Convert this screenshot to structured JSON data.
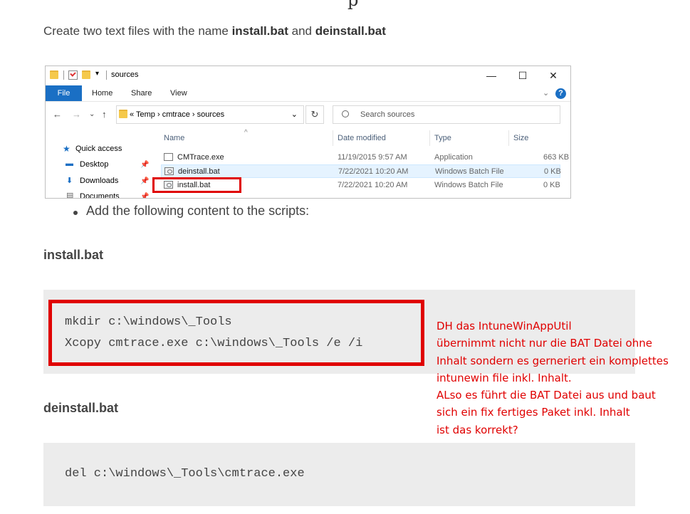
{
  "page": {
    "top_heading_fragment": "p",
    "intro_prefix": "Create two text files with the name ",
    "intro_file1": "install.bat",
    "intro_mid": " and ",
    "intro_file2": "deinstall.bat",
    "bullet_text": "Add the following content to the scripts:",
    "install_heading": "install.bat",
    "install_code": [
      "mkdir c:\\windows\\_Tools",
      "Xcopy cmtrace.exe c:\\windows\\_Tools /e /i"
    ],
    "deinstall_heading": "deinstall.bat",
    "deinstall_code": [
      "del c:\\windows\\_Tools\\cmtrace.exe"
    ],
    "annotation": "DH das IntuneWinAppUtil\nübernimmt nicht nur die BAT Datei ohne\nInhalt sondern es gerneriert ein komplettes\nintunewin file inkl. Inhalt.\nALso es führt die BAT Datei aus und baut\nsich ein fix fertiges Paket inkl. Inhalt\nist das korrekt?",
    "annotation_color": "#e00000"
  },
  "explorer": {
    "title": "sources",
    "window_controls": {
      "minimize": "—",
      "maximize": "☐",
      "close": "✕"
    },
    "ribbon_tabs": [
      "File",
      "Home",
      "Share",
      "View"
    ],
    "ribbon_expand": "⌄",
    "help": "?",
    "nav": {
      "back": "←",
      "forward": "→",
      "recent": "⌄",
      "up": "↑"
    },
    "address_prefix": "«",
    "breadcrumb": [
      "Temp",
      "cmtrace",
      "sources"
    ],
    "breadcrumb_sep": "›",
    "address_dropdown": "⌄",
    "refresh": "↻",
    "search_placeholder": "Search sources",
    "sort_indicator": "^",
    "columns": {
      "name": "Name",
      "date": "Date modified",
      "type": "Type",
      "size": "Size"
    },
    "sidebar": [
      {
        "label": "Quick access",
        "icon": "★"
      },
      {
        "label": "Desktop",
        "icon": "▬"
      },
      {
        "label": "Downloads",
        "icon": "⬇"
      },
      {
        "label": "Documents",
        "icon": "▤"
      }
    ],
    "pin_icon": "📌",
    "files": [
      {
        "name": "CMTrace.exe",
        "date": "11/19/2015 9:57 AM",
        "type": "Application",
        "size": "663 KB"
      },
      {
        "name": "deinstall.bat",
        "date": "7/22/2021 10:20 AM",
        "type": "Windows Batch File",
        "size": "0 KB"
      },
      {
        "name": "install.bat",
        "date": "7/22/2021 10:20 AM",
        "type": "Windows Batch File",
        "size": "0 KB"
      }
    ],
    "accent_color": "#1a6fc4"
  }
}
